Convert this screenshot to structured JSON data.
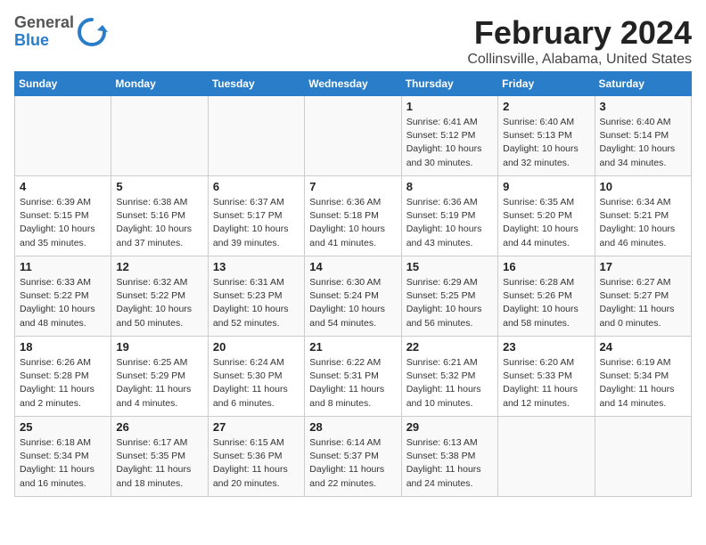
{
  "logo": {
    "line1": "General",
    "line2": "Blue"
  },
  "title": "February 2024",
  "subtitle": "Collinsville, Alabama, United States",
  "weekdays": [
    "Sunday",
    "Monday",
    "Tuesday",
    "Wednesday",
    "Thursday",
    "Friday",
    "Saturday"
  ],
  "weeks": [
    [
      {
        "day": "",
        "info": ""
      },
      {
        "day": "",
        "info": ""
      },
      {
        "day": "",
        "info": ""
      },
      {
        "day": "",
        "info": ""
      },
      {
        "day": "1",
        "info": "Sunrise: 6:41 AM\nSunset: 5:12 PM\nDaylight: 10 hours and 30 minutes."
      },
      {
        "day": "2",
        "info": "Sunrise: 6:40 AM\nSunset: 5:13 PM\nDaylight: 10 hours and 32 minutes."
      },
      {
        "day": "3",
        "info": "Sunrise: 6:40 AM\nSunset: 5:14 PM\nDaylight: 10 hours and 34 minutes."
      }
    ],
    [
      {
        "day": "4",
        "info": "Sunrise: 6:39 AM\nSunset: 5:15 PM\nDaylight: 10 hours and 35 minutes."
      },
      {
        "day": "5",
        "info": "Sunrise: 6:38 AM\nSunset: 5:16 PM\nDaylight: 10 hours and 37 minutes."
      },
      {
        "day": "6",
        "info": "Sunrise: 6:37 AM\nSunset: 5:17 PM\nDaylight: 10 hours and 39 minutes."
      },
      {
        "day": "7",
        "info": "Sunrise: 6:36 AM\nSunset: 5:18 PM\nDaylight: 10 hours and 41 minutes."
      },
      {
        "day": "8",
        "info": "Sunrise: 6:36 AM\nSunset: 5:19 PM\nDaylight: 10 hours and 43 minutes."
      },
      {
        "day": "9",
        "info": "Sunrise: 6:35 AM\nSunset: 5:20 PM\nDaylight: 10 hours and 44 minutes."
      },
      {
        "day": "10",
        "info": "Sunrise: 6:34 AM\nSunset: 5:21 PM\nDaylight: 10 hours and 46 minutes."
      }
    ],
    [
      {
        "day": "11",
        "info": "Sunrise: 6:33 AM\nSunset: 5:22 PM\nDaylight: 10 hours and 48 minutes."
      },
      {
        "day": "12",
        "info": "Sunrise: 6:32 AM\nSunset: 5:22 PM\nDaylight: 10 hours and 50 minutes."
      },
      {
        "day": "13",
        "info": "Sunrise: 6:31 AM\nSunset: 5:23 PM\nDaylight: 10 hours and 52 minutes."
      },
      {
        "day": "14",
        "info": "Sunrise: 6:30 AM\nSunset: 5:24 PM\nDaylight: 10 hours and 54 minutes."
      },
      {
        "day": "15",
        "info": "Sunrise: 6:29 AM\nSunset: 5:25 PM\nDaylight: 10 hours and 56 minutes."
      },
      {
        "day": "16",
        "info": "Sunrise: 6:28 AM\nSunset: 5:26 PM\nDaylight: 10 hours and 58 minutes."
      },
      {
        "day": "17",
        "info": "Sunrise: 6:27 AM\nSunset: 5:27 PM\nDaylight: 11 hours and 0 minutes."
      }
    ],
    [
      {
        "day": "18",
        "info": "Sunrise: 6:26 AM\nSunset: 5:28 PM\nDaylight: 11 hours and 2 minutes."
      },
      {
        "day": "19",
        "info": "Sunrise: 6:25 AM\nSunset: 5:29 PM\nDaylight: 11 hours and 4 minutes."
      },
      {
        "day": "20",
        "info": "Sunrise: 6:24 AM\nSunset: 5:30 PM\nDaylight: 11 hours and 6 minutes."
      },
      {
        "day": "21",
        "info": "Sunrise: 6:22 AM\nSunset: 5:31 PM\nDaylight: 11 hours and 8 minutes."
      },
      {
        "day": "22",
        "info": "Sunrise: 6:21 AM\nSunset: 5:32 PM\nDaylight: 11 hours and 10 minutes."
      },
      {
        "day": "23",
        "info": "Sunrise: 6:20 AM\nSunset: 5:33 PM\nDaylight: 11 hours and 12 minutes."
      },
      {
        "day": "24",
        "info": "Sunrise: 6:19 AM\nSunset: 5:34 PM\nDaylight: 11 hours and 14 minutes."
      }
    ],
    [
      {
        "day": "25",
        "info": "Sunrise: 6:18 AM\nSunset: 5:34 PM\nDaylight: 11 hours and 16 minutes."
      },
      {
        "day": "26",
        "info": "Sunrise: 6:17 AM\nSunset: 5:35 PM\nDaylight: 11 hours and 18 minutes."
      },
      {
        "day": "27",
        "info": "Sunrise: 6:15 AM\nSunset: 5:36 PM\nDaylight: 11 hours and 20 minutes."
      },
      {
        "day": "28",
        "info": "Sunrise: 6:14 AM\nSunset: 5:37 PM\nDaylight: 11 hours and 22 minutes."
      },
      {
        "day": "29",
        "info": "Sunrise: 6:13 AM\nSunset: 5:38 PM\nDaylight: 11 hours and 24 minutes."
      },
      {
        "day": "",
        "info": ""
      },
      {
        "day": "",
        "info": ""
      }
    ]
  ]
}
